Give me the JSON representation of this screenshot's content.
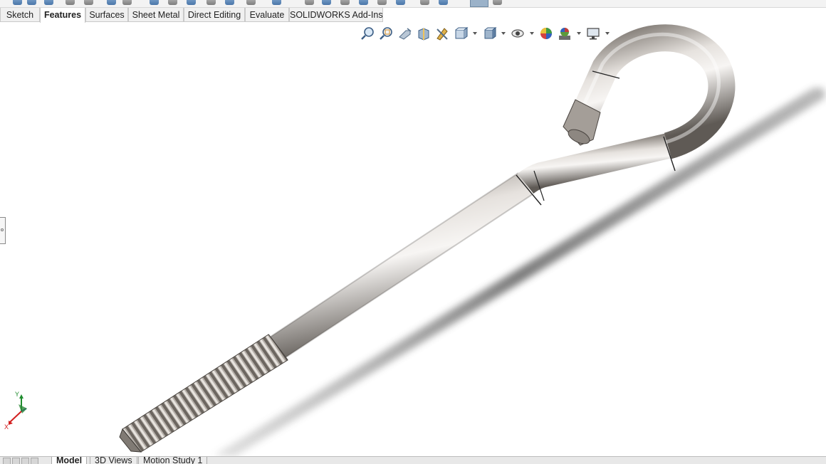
{
  "command_tabs": [
    {
      "label": "Sketch",
      "active": false
    },
    {
      "label": "Features",
      "active": true
    },
    {
      "label": "Surfaces",
      "active": false
    },
    {
      "label": "Sheet Metal",
      "active": false
    },
    {
      "label": "Direct Editing",
      "active": false
    },
    {
      "label": "Evaluate",
      "active": false
    },
    {
      "label": "SOLIDWORKS Add-Ins",
      "active": false
    }
  ],
  "view_toolbar": [
    {
      "icon": "zoom-to-fit-icon"
    },
    {
      "icon": "zoom-to-area-icon"
    },
    {
      "icon": "previous-view-icon"
    },
    {
      "icon": "section-view-icon"
    },
    {
      "icon": "dynamic-annotation-views-icon"
    },
    {
      "icon": "view-orientation-icon"
    },
    {
      "icon": "display-style-icon"
    },
    {
      "icon": "hide-show-items-icon"
    },
    {
      "icon": "edit-appearance-icon"
    },
    {
      "icon": "apply-scene-icon"
    },
    {
      "icon": "view-settings-icon"
    }
  ],
  "triad": {
    "x_label": "X",
    "y_label": "Y",
    "z_label": "Z"
  },
  "bottom_tabs": [
    {
      "label": "Model",
      "active": true
    },
    {
      "label": "3D Views",
      "active": false
    },
    {
      "label": "Motion Study 1",
      "active": false
    }
  ],
  "colors": {
    "accent": "#4a76a8",
    "part_metal": "#b8b2ac",
    "shadow": "#6b6b6b",
    "axis_x": "#d21e1e",
    "axis_y": "#1f8c2e",
    "axis_z": "#2847c8"
  }
}
